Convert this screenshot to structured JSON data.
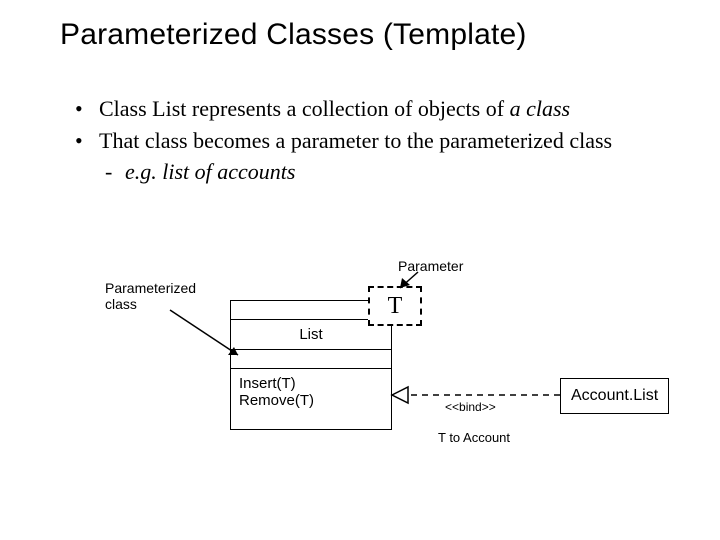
{
  "title": "Parameterized Classes (Template)",
  "bullets": {
    "b1_prefix": "Class List represents a collection of objects of ",
    "b1_italic": "a class",
    "b2": "That class becomes a parameter to the parameterized class",
    "s1_prefix": "e.g. ",
    "s1_italic": "list of accounts"
  },
  "labels": {
    "parameterized_class_l1": "Parameterized",
    "parameterized_class_l2": "class",
    "parameter": "Parameter"
  },
  "uml": {
    "class_name": "List",
    "op1": "Insert(T)",
    "op2": "Remove(T)",
    "template_param": "T",
    "bind_stereo": "<<bind>>",
    "binding_text": "T to Account",
    "bound_class": "Account.List"
  }
}
